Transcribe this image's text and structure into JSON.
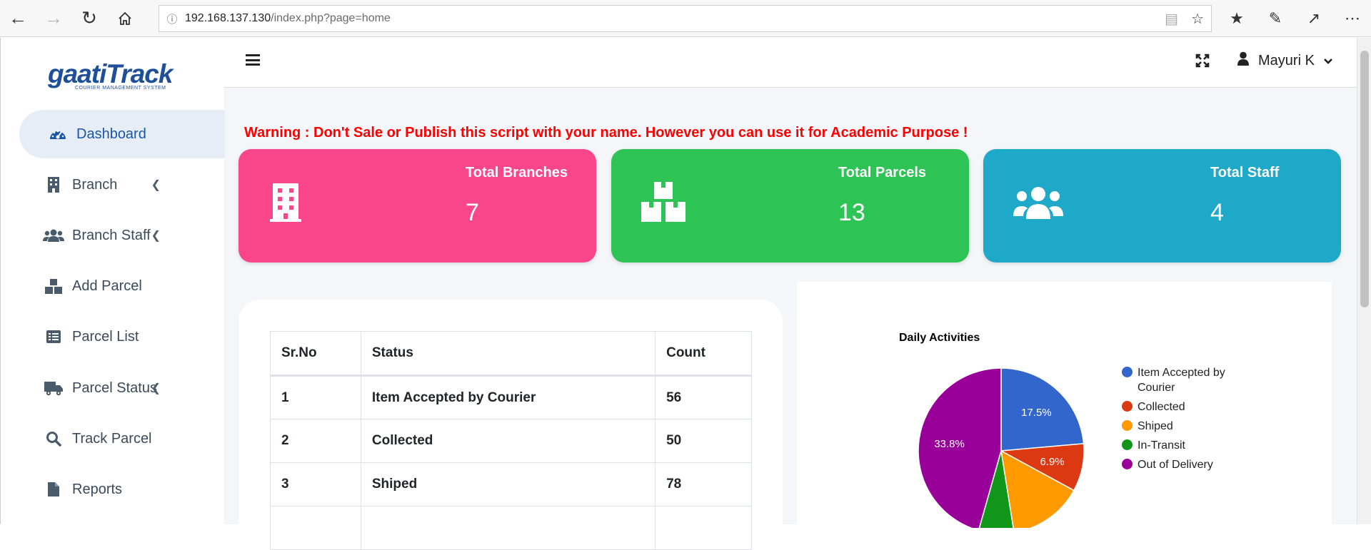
{
  "browser": {
    "url_host": "192.168.137.130",
    "url_path": "/index.php?page=home"
  },
  "brand": {
    "logo_word": "gaatiTrack",
    "logo_sub": "COURIER MANAGEMENT SYSTEM"
  },
  "sidebar": {
    "items": [
      {
        "label": "Dashboard",
        "icon": "dashboard-icon",
        "active": true
      },
      {
        "label": "Branch",
        "icon": "building-icon",
        "has_submenu": true
      },
      {
        "label": "Branch Staff",
        "icon": "users-icon",
        "has_submenu": true
      },
      {
        "label": "Add Parcel",
        "icon": "boxes-icon"
      },
      {
        "label": "Parcel List",
        "icon": "list-icon"
      },
      {
        "label": "Parcel Status",
        "icon": "truck-icon",
        "has_submenu": true
      },
      {
        "label": "Track Parcel",
        "icon": "search-icon"
      },
      {
        "label": "Reports",
        "icon": "file-icon"
      }
    ]
  },
  "topbar": {
    "user_name": "Mayuri K"
  },
  "warning": "Warning : Don't Sale or Publish this script with your name. However you can use it for Academic Purpose !",
  "stats": [
    {
      "label": "Total Branches",
      "value": "7",
      "color": "#f9468a",
      "icon": "building-icon"
    },
    {
      "label": "Total Parcels",
      "value": "13",
      "color": "#2dc455",
      "icon": "boxes-icon"
    },
    {
      "label": "Total Staff",
      "value": "4",
      "color": "#1ea9c9",
      "icon": "users-icon"
    }
  ],
  "status_table": {
    "headers": [
      "Sr.No",
      "Status",
      "Count"
    ],
    "rows": [
      [
        "1",
        "Item Accepted by Courier",
        "56"
      ],
      [
        "2",
        "Collected",
        "50"
      ],
      [
        "3",
        "Shiped",
        "78"
      ]
    ]
  },
  "chart_data": {
    "type": "pie",
    "title": "Daily Activities",
    "slices": [
      {
        "name": "Item Accepted by Courier",
        "value": 17.5,
        "color": "#3366cc",
        "label": "17.5%"
      },
      {
        "name": "Collected",
        "value": 6.9,
        "color": "#dc3912",
        "label": "6.9%"
      },
      {
        "name": "Shiped",
        "value": 10.8,
        "color": "#ff9900",
        "label": ""
      },
      {
        "name": "In-Transit",
        "value": 5.1,
        "color": "#109618",
        "label": ""
      },
      {
        "name": "Out of Delivery",
        "value": 33.8,
        "color": "#990099",
        "label": "33.8%"
      }
    ],
    "legend_position": "right"
  }
}
